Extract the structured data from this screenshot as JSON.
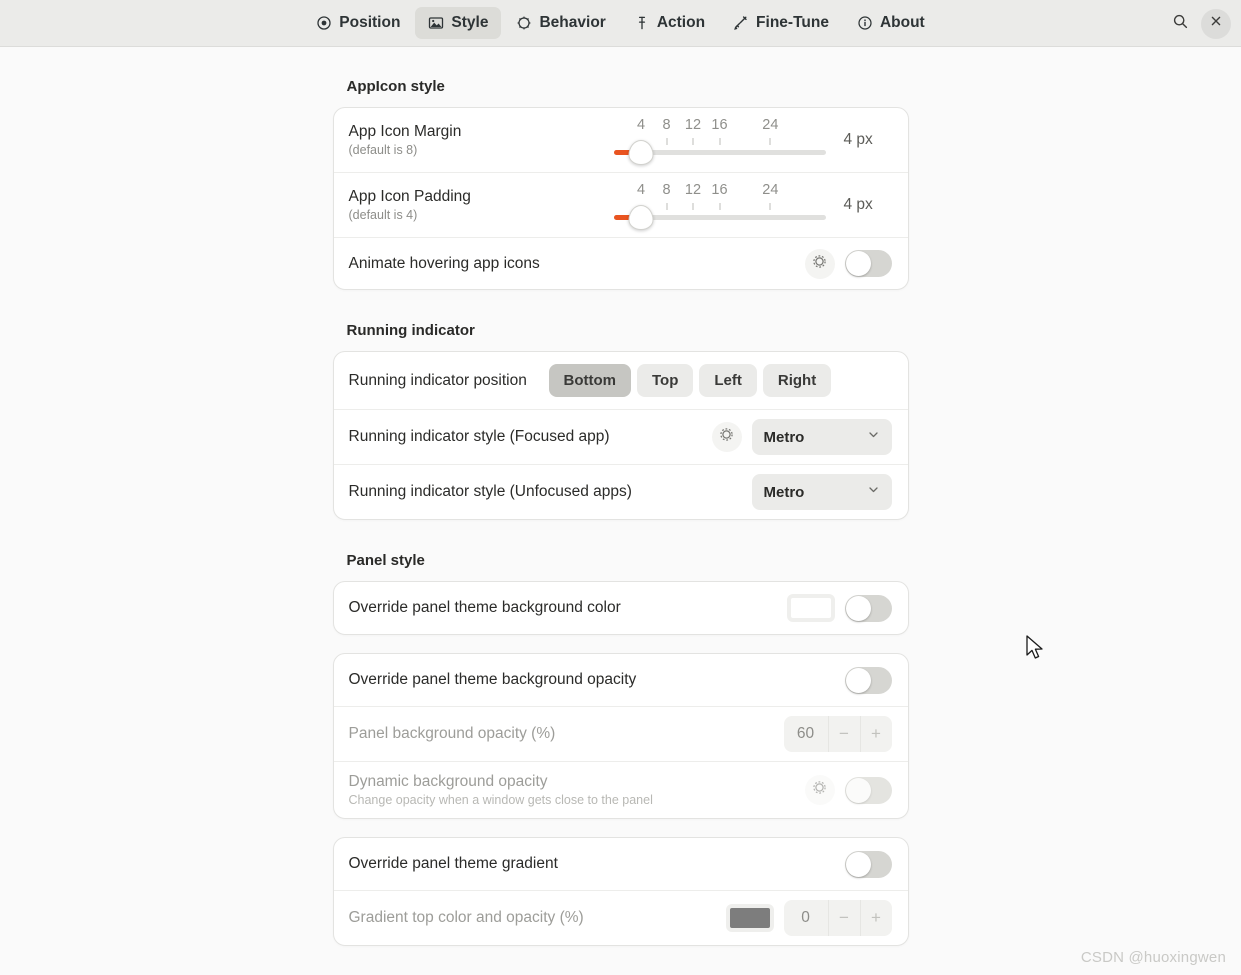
{
  "header": {
    "tabs": [
      {
        "label": "Position",
        "icon": "position-icon",
        "active": false
      },
      {
        "label": "Style",
        "icon": "image-icon",
        "active": true
      },
      {
        "label": "Behavior",
        "icon": "behavior-icon",
        "active": false
      },
      {
        "label": "Action",
        "icon": "action-icon",
        "active": false
      },
      {
        "label": "Fine-Tune",
        "icon": "wrench-icon",
        "active": false
      },
      {
        "label": "About",
        "icon": "info-icon",
        "active": false
      }
    ],
    "search_icon": "search-icon",
    "close_icon": "close-icon"
  },
  "accent_color": "#e95420",
  "groups": {
    "appicon": {
      "title": "AppIcon style",
      "margin": {
        "title": "App Icon Margin",
        "subtitle": "(default is 8)",
        "value": 4,
        "value_label": "4 px",
        "min": 0,
        "max": 48,
        "marks": [
          4,
          8,
          12,
          16,
          24
        ]
      },
      "padding": {
        "title": "App Icon Padding",
        "subtitle": "(default is 4)",
        "value": 4,
        "value_label": "4 px",
        "min": 0,
        "max": 48,
        "marks": [
          4,
          8,
          12,
          16,
          24
        ]
      },
      "animate": {
        "title": "Animate hovering app icons",
        "reset_icon": "gear-icon",
        "toggle_on": false
      }
    },
    "running_indicator": {
      "title": "Running indicator",
      "position": {
        "title": "Running indicator position",
        "options": [
          "Bottom",
          "Top",
          "Left",
          "Right"
        ],
        "selected": "Bottom"
      },
      "style_focused": {
        "title": "Running indicator style (Focused app)",
        "reset_icon": "gear-icon",
        "selected": "Metro",
        "chevron": "chevron-down-icon"
      },
      "style_unfocused": {
        "title": "Running indicator style (Unfocused apps)",
        "selected": "Metro",
        "chevron": "chevron-down-icon"
      }
    },
    "panel": {
      "title": "Panel style",
      "override_bg_color": {
        "title": "Override panel theme background color",
        "swatch_color": "#ffffff",
        "toggle_on": false
      },
      "override_bg_opacity": {
        "title": "Override panel theme background opacity",
        "toggle_on": false
      },
      "bg_opacity": {
        "title": "Panel background opacity (%)",
        "value": "60",
        "minus": "−",
        "plus": "+",
        "disabled": true
      },
      "dynamic_opacity": {
        "title": "Dynamic background opacity",
        "subtitle": "Change opacity when a window gets close to the panel",
        "reset_icon": "gear-icon",
        "toggle_on": false,
        "disabled": true
      },
      "override_gradient": {
        "title": "Override panel theme gradient",
        "toggle_on": false
      },
      "gradient_top": {
        "title": "Gradient top color and opacity (%)",
        "swatch_color": "#7d7d7d",
        "value": "0",
        "minus": "−",
        "plus": "+",
        "disabled": true
      }
    }
  },
  "watermark": "CSDN @huoxingwen"
}
